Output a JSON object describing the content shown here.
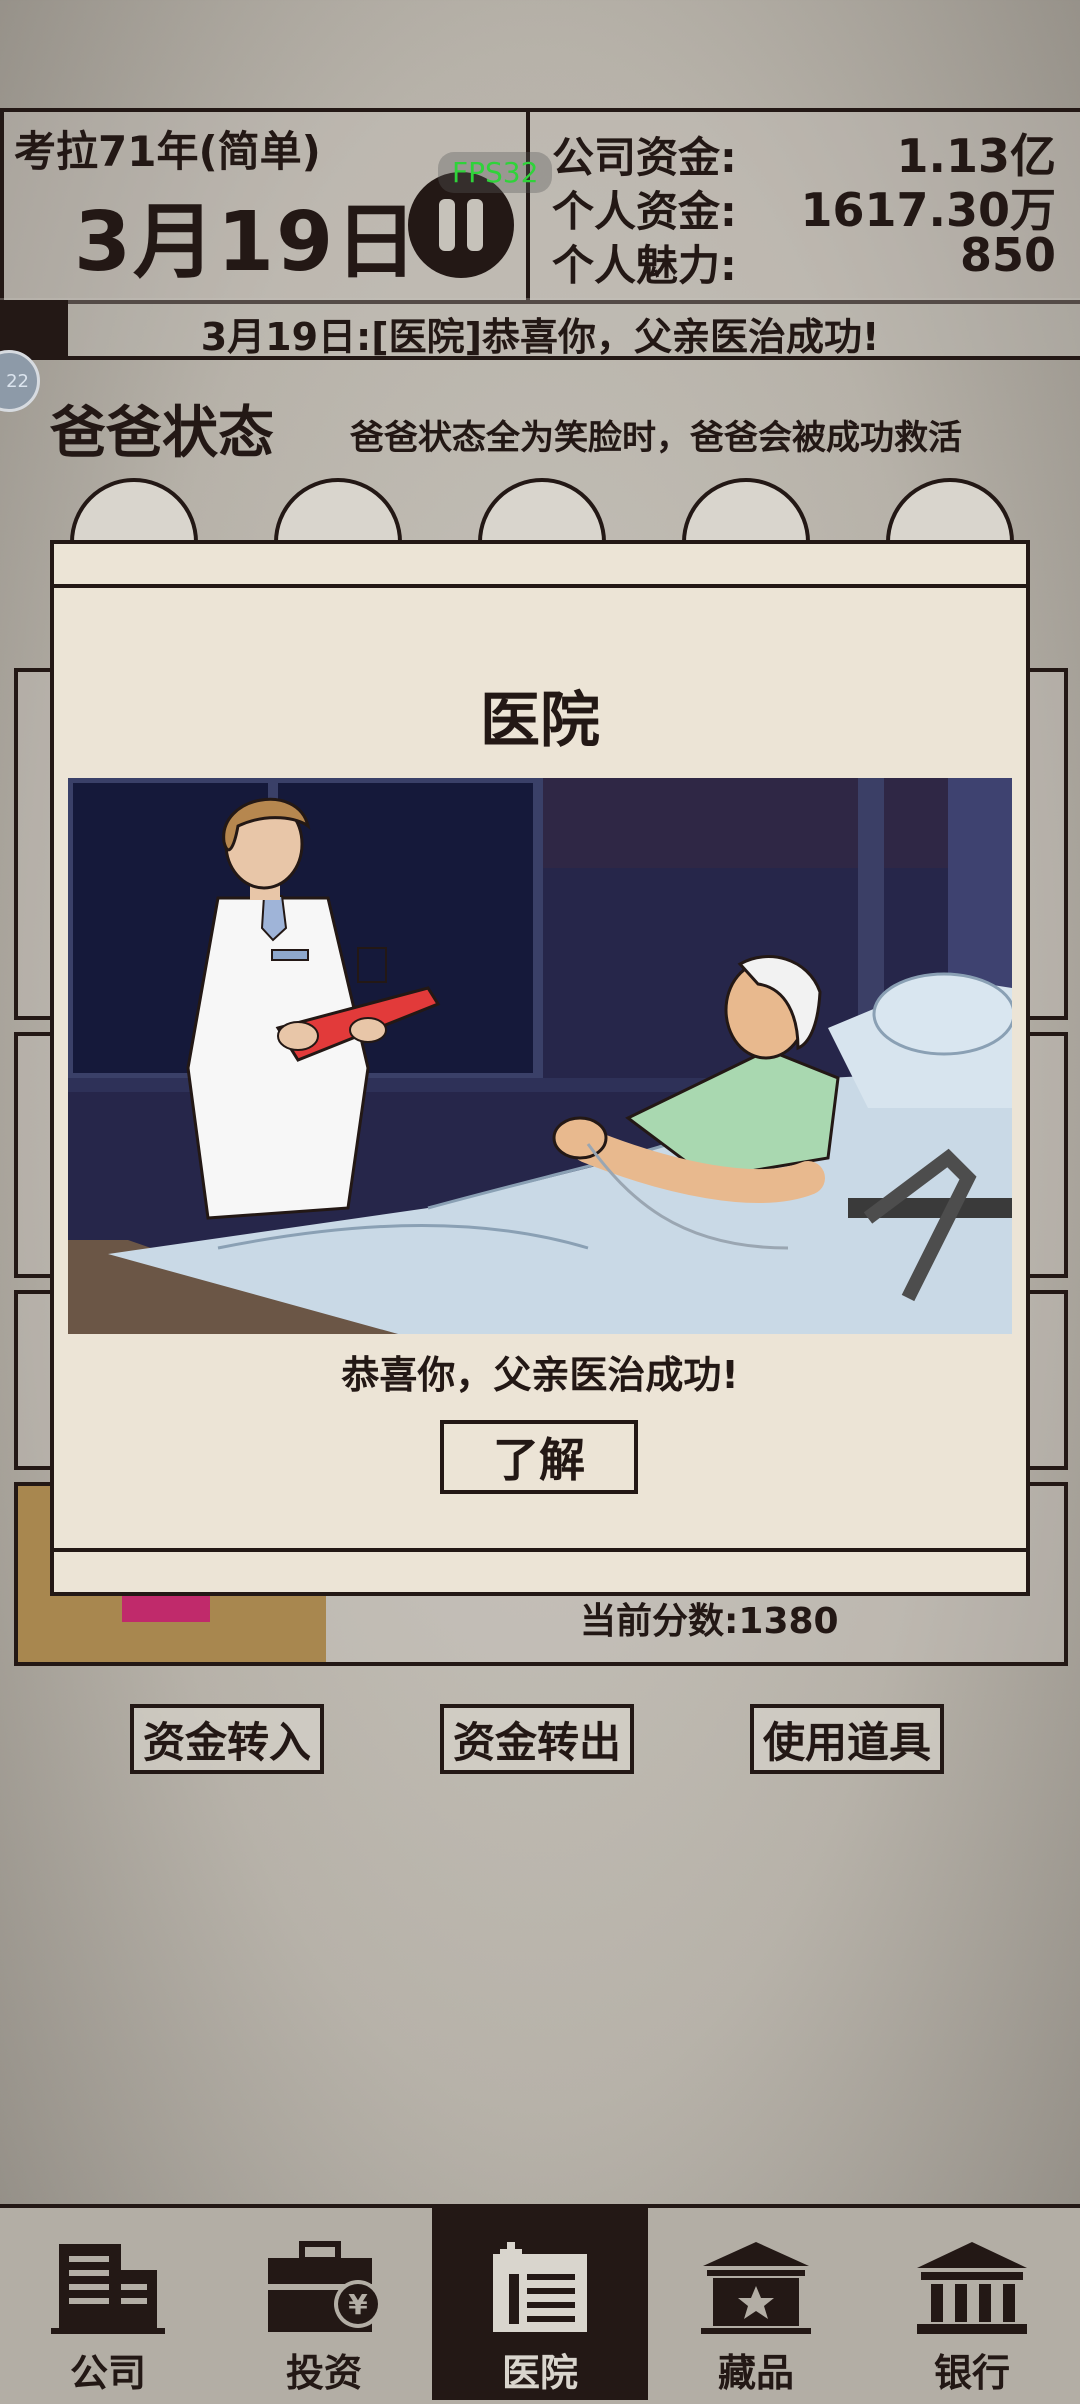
{
  "header": {
    "game_title": "考拉71年(简单)",
    "date": "3月19日",
    "fps": "FPS32",
    "stats": [
      {
        "label": "公司资金:",
        "value": "1.13亿"
      },
      {
        "label": "个人资金:",
        "value": "1617.30万"
      },
      {
        "label": "个人魅力:",
        "value": "850"
      }
    ]
  },
  "ticker": {
    "text": "3月19日:[医院]恭喜你，父亲医治成功!"
  },
  "side_badge": {
    "text": "22"
  },
  "dad_status": {
    "title": "爸爸状态",
    "hint": "爸爸状态全为笑脸时，爸爸会被成功救活",
    "faces": [
      "smile-icon",
      "smile-icon",
      "smile-icon",
      "smile-icon",
      "smile-icon"
    ]
  },
  "background_card": {
    "score": "当前分数:1380"
  },
  "actions": [
    "资金转入",
    "资金转出",
    "使用道具"
  ],
  "nav": {
    "items": [
      {
        "label": "公司",
        "icon": "company-building-icon"
      },
      {
        "label": "投资",
        "icon": "briefcase-yen-icon"
      },
      {
        "label": "医院",
        "icon": "hospital-icon",
        "active": true
      },
      {
        "label": "藏品",
        "icon": "museum-star-icon"
      },
      {
        "label": "银行",
        "icon": "bank-icon"
      }
    ]
  },
  "modal": {
    "title": "医院",
    "message": "恭喜你，父亲医治成功!",
    "ok_label": "了解",
    "illustration": "doctor-and-patient-in-hospital-bed"
  },
  "colors": {
    "ink": "#231815",
    "paper": "#ece4d6",
    "background": "#b7b2a9",
    "fps_green": "#2fd33a",
    "night_window": "#1c1f3f",
    "sheet_blue": "#c9d9e6",
    "gown_green": "#a9d8b0"
  }
}
